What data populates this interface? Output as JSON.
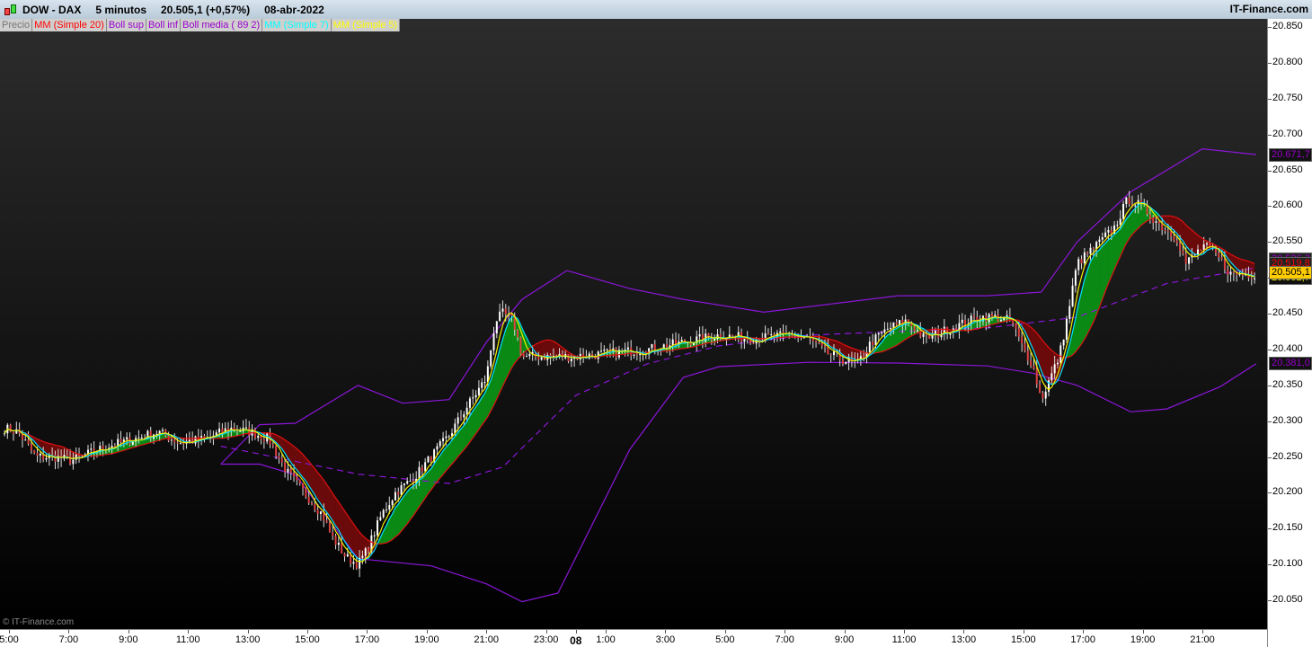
{
  "header": {
    "symbol": "DOW - DAX",
    "timeframe": "5 minutos",
    "price": "20.505,1 (+0,57%)",
    "date": "08-abr-2022",
    "site": "IT-Finance.com"
  },
  "legend": [
    {
      "label": "Precio",
      "color": "#777777"
    },
    {
      "label": "MM (Simple 20)",
      "color": "#ff0000"
    },
    {
      "label": "Boll sup",
      "color": "#9900cc"
    },
    {
      "label": "Boll inf",
      "color": "#9900cc"
    },
    {
      "label": "Boll media ( 89 2)",
      "color": "#9900cc"
    },
    {
      "label": "MM (Simple 7)",
      "color": "#00ffff"
    },
    {
      "label": "MM (Simple 5)",
      "color": "#ffff00"
    }
  ],
  "copyright": "© IT-Finance.com",
  "price_tags": [
    {
      "label": "20.671,7",
      "value": 20671.7,
      "fg": "#9900cc",
      "bg": "#111111"
    },
    {
      "label": "20.526,3",
      "value": 20526.3,
      "fg": "#9900cc",
      "bg": "#222222"
    },
    {
      "label": "20.519,8",
      "value": 20519.8,
      "fg": "#ff0000",
      "bg": "#222222"
    },
    {
      "label": "20.502,7",
      "value": 20500.5,
      "fg": "#ffff00",
      "bg": "#111111"
    },
    {
      "label": "20.505,1",
      "value": 20507.5,
      "fg": "#000000",
      "bg": "#ffcc00"
    },
    {
      "label": "20.381,0",
      "value": 20381.0,
      "fg": "#9900cc",
      "bg": "#111111"
    }
  ],
  "chart_data": {
    "type": "candlestick",
    "ylim": [
      20050,
      20850
    ],
    "yticks": [
      "20.850",
      "20.800",
      "20.750",
      "20.700",
      "20.650",
      "20.600",
      "20.550",
      "20.500",
      "20.450",
      "20.400",
      "20.350",
      "20.300",
      "20.250",
      "20.200",
      "20.150",
      "20.100",
      "20.050"
    ],
    "xlim_hours": [
      4.7,
      47.2
    ],
    "xticks": [
      {
        "t": 5,
        "label": "5:00"
      },
      {
        "t": 7,
        "label": "7:00"
      },
      {
        "t": 9,
        "label": "9:00"
      },
      {
        "t": 11,
        "label": "11:00"
      },
      {
        "t": 13,
        "label": "13:00"
      },
      {
        "t": 15,
        "label": "15:00"
      },
      {
        "t": 17,
        "label": "17:00"
      },
      {
        "t": 19,
        "label": "19:00"
      },
      {
        "t": 21,
        "label": "21:00"
      },
      {
        "t": 23,
        "label": "23:00"
      },
      {
        "t": 24,
        "label": "08",
        "bold": true
      },
      {
        "t": 25,
        "label": "1:00"
      },
      {
        "t": 27,
        "label": "3:00"
      },
      {
        "t": 29,
        "label": "5:00"
      },
      {
        "t": 31,
        "label": "7:00"
      },
      {
        "t": 33,
        "label": "9:00"
      },
      {
        "t": 35,
        "label": "11:00"
      },
      {
        "t": 37,
        "label": "13:00"
      },
      {
        "t": 39,
        "label": "15:00"
      },
      {
        "t": 41,
        "label": "17:00"
      },
      {
        "t": 43,
        "label": "19:00"
      },
      {
        "t": 45,
        "label": "21:00"
      }
    ],
    "close": [
      [
        4.85,
        20290
      ],
      [
        5.3,
        20285
      ],
      [
        5.9,
        20250
      ],
      [
        6.5,
        20250
      ],
      [
        7.1,
        20245
      ],
      [
        7.7,
        20255
      ],
      [
        8.3,
        20265
      ],
      [
        9.2,
        20275
      ],
      [
        10.0,
        20285
      ],
      [
        10.7,
        20270
      ],
      [
        11.6,
        20275
      ],
      [
        12.4,
        20290
      ],
      [
        13.1,
        20285
      ],
      [
        13.7,
        20275
      ],
      [
        14.3,
        20230
      ],
      [
        14.9,
        20200
      ],
      [
        15.5,
        20170
      ],
      [
        15.8,
        20140
      ],
      [
        16.3,
        20110
      ],
      [
        16.7,
        20100
      ],
      [
        17.0,
        20120
      ],
      [
        17.5,
        20170
      ],
      [
        17.95,
        20200
      ],
      [
        18.55,
        20220
      ],
      [
        19.15,
        20250
      ],
      [
        19.75,
        20280
      ],
      [
        20.35,
        20320
      ],
      [
        21.0,
        20360
      ],
      [
        21.3,
        20440
      ],
      [
        21.55,
        20450
      ],
      [
        21.9,
        20440
      ],
      [
        22.2,
        20390
      ],
      [
        22.8,
        20390
      ],
      [
        24.0,
        20390
      ],
      [
        25.2,
        20395
      ],
      [
        26.4,
        20400
      ],
      [
        27.6,
        20410
      ],
      [
        28.8,
        20420
      ],
      [
        30.0,
        20415
      ],
      [
        31.2,
        20420
      ],
      [
        31.8,
        20415
      ],
      [
        32.4,
        20395
      ],
      [
        33.0,
        20385
      ],
      [
        33.45,
        20380
      ],
      [
        33.9,
        20410
      ],
      [
        34.5,
        20430
      ],
      [
        35.1,
        20440
      ],
      [
        35.7,
        20415
      ],
      [
        36.3,
        20425
      ],
      [
        36.9,
        20435
      ],
      [
        37.5,
        20445
      ],
      [
        38.1,
        20445
      ],
      [
        38.6,
        20440
      ],
      [
        39.0,
        20400
      ],
      [
        39.3,
        20380
      ],
      [
        39.6,
        20330
      ],
      [
        39.9,
        20360
      ],
      [
        40.2,
        20390
      ],
      [
        40.5,
        20450
      ],
      [
        40.8,
        20520
      ],
      [
        41.45,
        20545
      ],
      [
        42.05,
        20570
      ],
      [
        42.5,
        20610
      ],
      [
        42.95,
        20600
      ],
      [
        43.55,
        20575
      ],
      [
        44.15,
        20555
      ],
      [
        44.45,
        20520
      ],
      [
        45.05,
        20545
      ],
      [
        45.5,
        20530
      ],
      [
        45.95,
        20505
      ],
      [
        46.8,
        20505
      ]
    ],
    "boll_sup": [
      [
        12.1,
        20240
      ],
      [
        13.4,
        20295
      ],
      [
        14.6,
        20297
      ],
      [
        16.7,
        20350
      ],
      [
        18.2,
        20325
      ],
      [
        19.75,
        20330
      ],
      [
        21.0,
        20410
      ],
      [
        22.2,
        20470
      ],
      [
        23.7,
        20510
      ],
      [
        25.8,
        20485
      ],
      [
        27.6,
        20470
      ],
      [
        30.3,
        20452
      ],
      [
        34.8,
        20475
      ],
      [
        37.8,
        20475
      ],
      [
        39.6,
        20480
      ],
      [
        40.8,
        20550
      ],
      [
        42.6,
        20620
      ],
      [
        45.0,
        20680
      ],
      [
        46.8,
        20672
      ]
    ],
    "boll_inf": [
      [
        12.1,
        20240
      ],
      [
        13.4,
        20240
      ],
      [
        14.6,
        20225
      ],
      [
        16.7,
        20108
      ],
      [
        19.15,
        20098
      ],
      [
        21.0,
        20073
      ],
      [
        22.2,
        20048
      ],
      [
        23.4,
        20060
      ],
      [
        24.3,
        20135
      ],
      [
        25.8,
        20260
      ],
      [
        27.6,
        20361
      ],
      [
        28.8,
        20376
      ],
      [
        31.8,
        20382
      ],
      [
        34.8,
        20381
      ],
      [
        37.8,
        20377
      ],
      [
        39.3,
        20367
      ],
      [
        40.8,
        20350
      ],
      [
        42.6,
        20313
      ],
      [
        43.8,
        20317
      ],
      [
        45.6,
        20348
      ],
      [
        46.8,
        20380
      ]
    ],
    "boll_media": [
      [
        12.1,
        20265
      ],
      [
        16.7,
        20226
      ],
      [
        19.75,
        20213
      ],
      [
        21.55,
        20236
      ],
      [
        24.0,
        20336
      ],
      [
        26.4,
        20380
      ],
      [
        28.8,
        20405
      ],
      [
        31.8,
        20420
      ],
      [
        34.8,
        20425
      ],
      [
        37.8,
        20430
      ],
      [
        40.8,
        20445
      ],
      [
        43.8,
        20492
      ],
      [
        46.8,
        20514
      ]
    ]
  }
}
